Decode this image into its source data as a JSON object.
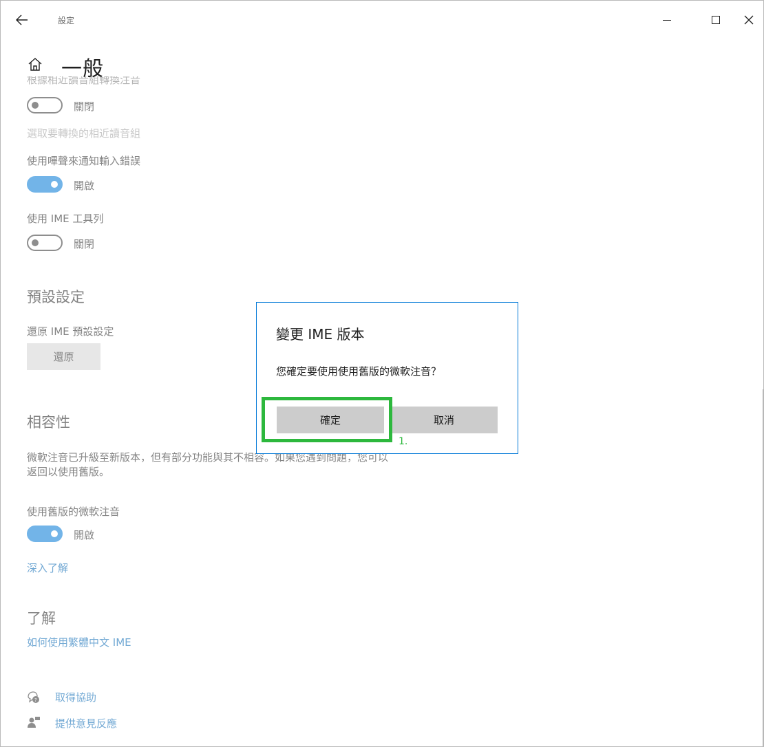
{
  "window": {
    "title": "設定"
  },
  "header": {
    "page_title": "一般",
    "cut_off_label": "根據相近讀音組轉換注音"
  },
  "settings": {
    "toggle1": {
      "state_label": "關閉",
      "on": false
    },
    "group_link_label": "選取要轉換的相近讀音組",
    "beep_label": "使用嗶聲來通知輸入錯誤",
    "toggle2": {
      "state_label": "開啟",
      "on": true
    },
    "toolbar_label": "使用 IME 工具列",
    "toggle3": {
      "state_label": "關閉",
      "on": false
    },
    "defaults_section": "預設設定",
    "restore_label": "還原 IME 預設設定",
    "restore_button": "還原",
    "compat_section": "相容性",
    "compat_paragraph": "微軟注音已升級至新版本，但有部分功能與其不相容。如果您遇到問題，您可以返回以使用舊版。",
    "old_version_label": "使用舊版的微軟注音",
    "toggle4": {
      "state_label": "開啟",
      "on": true
    },
    "learn_more_link": "深入了解",
    "about_section": "了解",
    "howto_link": "如何使用繁體中文 IME",
    "get_help_link": "取得協助",
    "feedback_link": "提供意見反應"
  },
  "dialog": {
    "title": "變更 IME 版本",
    "message": "您確定要使用使用舊版的微軟注音？",
    "ok_label": "確定",
    "cancel_label": "取消"
  },
  "annotation": {
    "label": "1.",
    "color": "#2db83d"
  },
  "colors": {
    "accent": "#0078d7",
    "link": "#0063b1"
  }
}
